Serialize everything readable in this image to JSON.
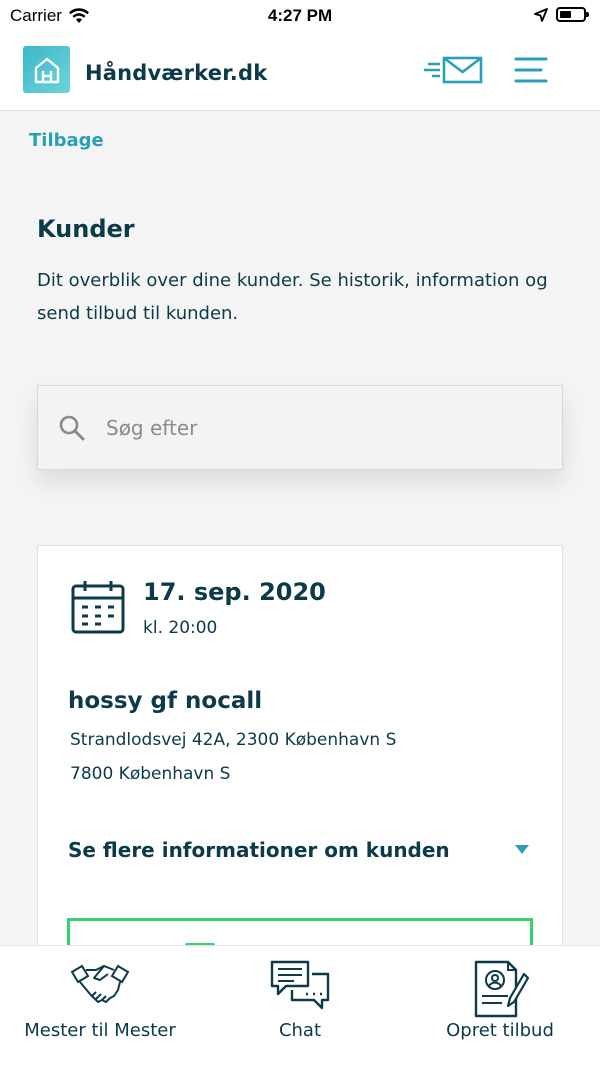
{
  "statusbar": {
    "carrier": "Carrier",
    "time": "4:27 PM"
  },
  "header": {
    "brand": "Håndværker.dk",
    "mail_icon": "mail-send-icon",
    "menu_icon": "hamburger-menu-icon"
  },
  "back_label": "Tilbage",
  "page": {
    "title": "Kunder",
    "description": "Dit overblik over dine kunder. Se historik, information og send tilbud til kunden."
  },
  "search": {
    "placeholder": "Søg efter",
    "value": ""
  },
  "customer_card": {
    "date": "17. sep. 2020",
    "time": "kl. 20:00",
    "name": "hossy gf nocall",
    "address_line1": "Strandlodsvej 42A, 2300 København S",
    "address_line2": "7800 København S",
    "more_info_label": "Se flere informationer om kunden"
  },
  "tabbar": {
    "items": [
      {
        "label": "Mester til Mester",
        "icon": "handshake-icon"
      },
      {
        "label": "Chat",
        "icon": "chat-bubbles-icon"
      },
      {
        "label": "Opret tilbud",
        "icon": "document-sign-icon"
      }
    ]
  },
  "colors": {
    "primary_dark": "#0c3a48",
    "accent_teal": "#2aa0b8",
    "logo_teal": "#3bb8c9",
    "accent_green": "#35d36b",
    "background": "#f4f4f4"
  }
}
